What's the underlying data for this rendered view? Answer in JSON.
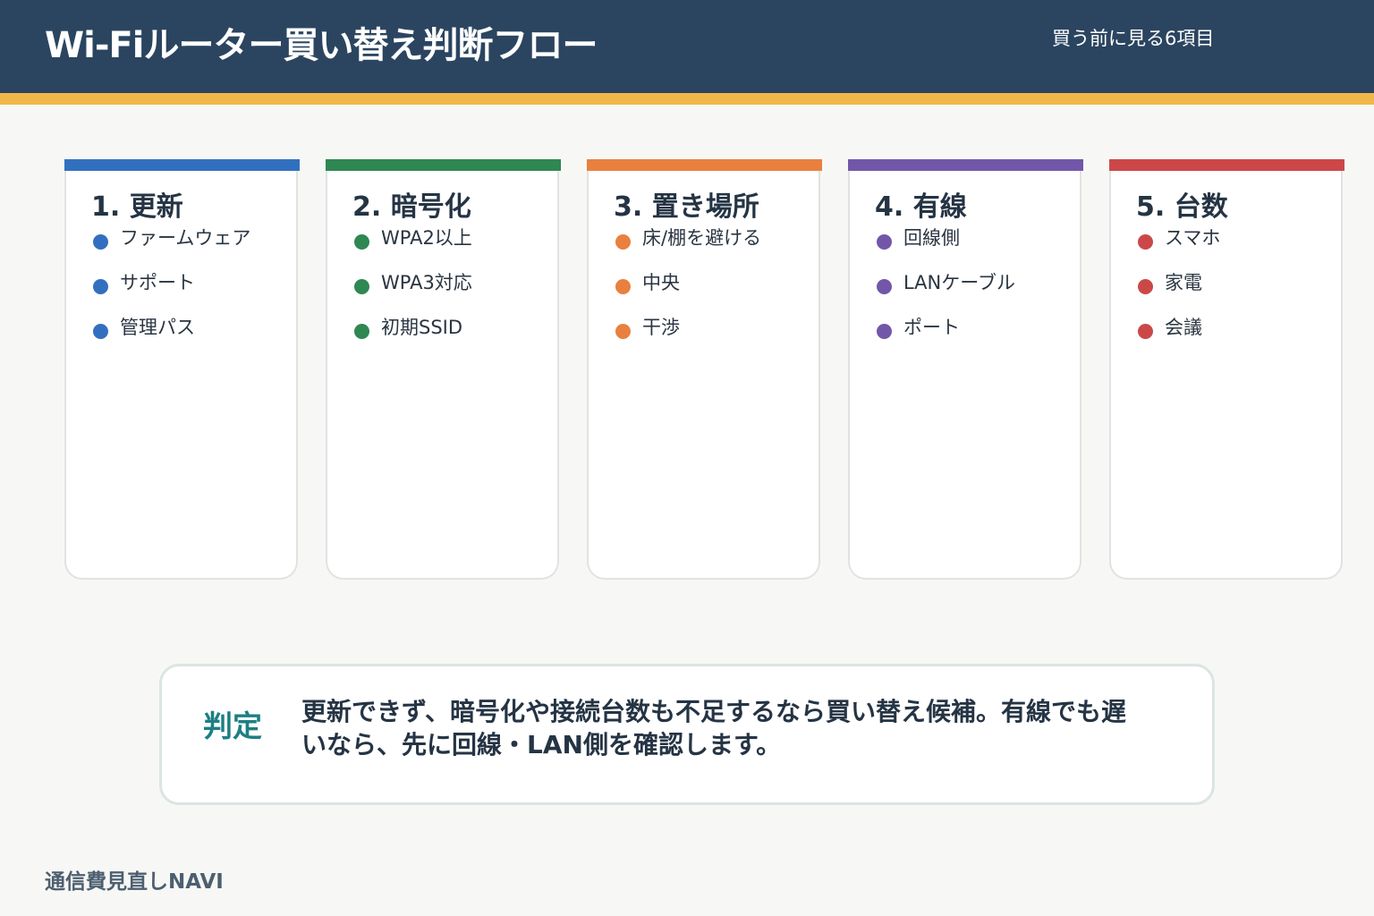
{
  "header": {
    "title": "Wi-Fiルーター買い替え判断フロー",
    "subtitle": "買う前に見る6項目"
  },
  "colors": {
    "header_bg": "#2b4560",
    "accent_bar": "#f0b84a",
    "verdict_label": "#1d7f83"
  },
  "cards": [
    {
      "title": "1. 更新",
      "color": "#3270bf",
      "items": [
        "ファームウェア",
        "サポート",
        "管理パス"
      ]
    },
    {
      "title": "2. 暗号化",
      "color": "#2f8752",
      "items": [
        "WPA2以上",
        "WPA3対応",
        "初期SSID"
      ]
    },
    {
      "title": "3. 置き場所",
      "color": "#e9803f",
      "items": [
        "床/棚を避ける",
        "中央",
        "干渉"
      ]
    },
    {
      "title": "4. 有線",
      "color": "#7257a9",
      "items": [
        "回線側",
        "LANケーブル",
        "ポート"
      ]
    },
    {
      "title": "5. 台数",
      "color": "#cc4848",
      "items": [
        "スマホ",
        "家電",
        "会議"
      ]
    }
  ],
  "verdict": {
    "label": "判定",
    "text": "更新できず、暗号化や接続台数も不足するなら買い替え候補。有線でも遅いなら、先に回線・LAN側を確認します。"
  },
  "footer": {
    "brand": "通信費見直しNAVI"
  }
}
